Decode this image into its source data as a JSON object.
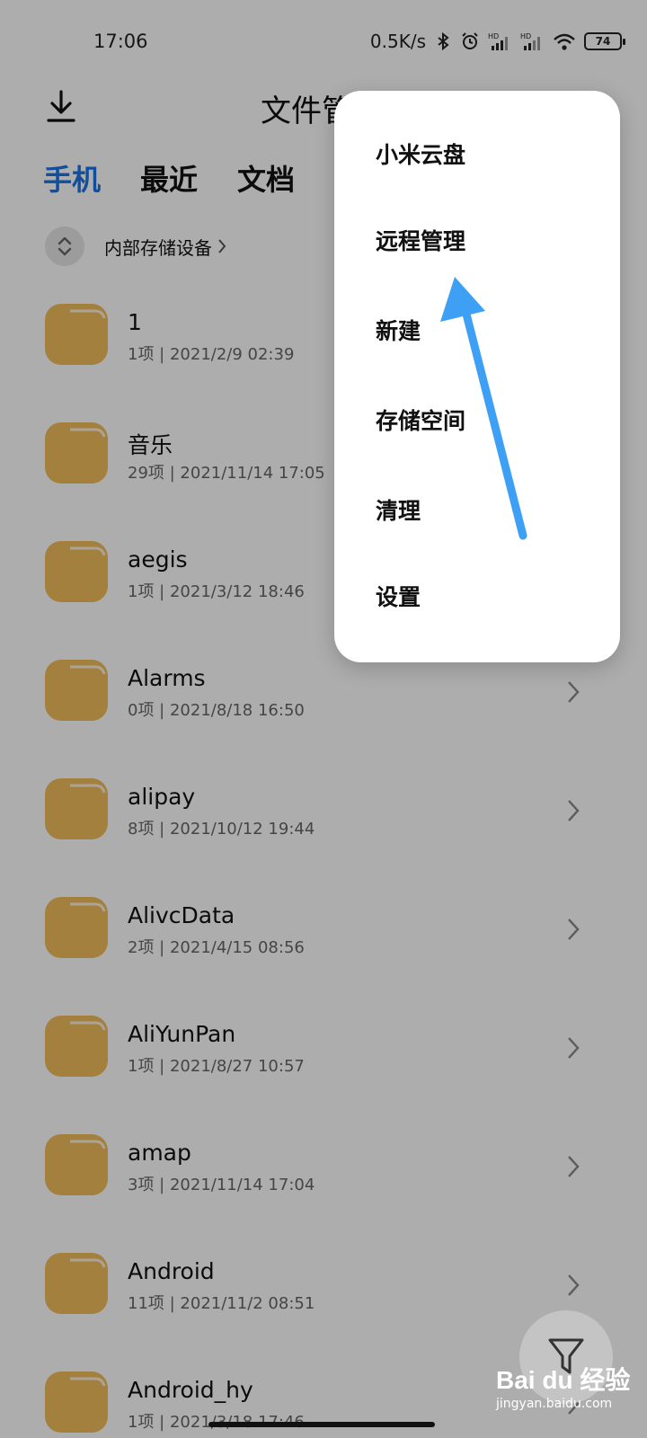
{
  "status_bar": {
    "time": "17:06",
    "net_speed": "0.5K/s",
    "battery": "74",
    "icons": [
      "bluetooth-icon",
      "alarm-icon",
      "hd-signal-icon",
      "hd-signal-icon",
      "wifi-icon",
      "battery-icon"
    ]
  },
  "header": {
    "title": "文件管理",
    "download_icon": "download-icon"
  },
  "tabs": [
    {
      "label": "手机",
      "active": true
    },
    {
      "label": "最近",
      "active": false
    },
    {
      "label": "文档",
      "active": false
    }
  ],
  "breadcrumb": {
    "label": "内部存储设备",
    "sort_icon": "sort-toggle-icon"
  },
  "files": [
    {
      "name": "1",
      "meta": "1项 | 2021/2/9 02:39"
    },
    {
      "name": "音乐",
      "meta": "29项 | 2021/11/14 17:05"
    },
    {
      "name": "aegis",
      "meta": "1项 | 2021/3/12 18:46"
    },
    {
      "name": "Alarms",
      "meta": "0项 | 2021/8/18 16:50"
    },
    {
      "name": "alipay",
      "meta": "8项 | 2021/10/12 19:44"
    },
    {
      "name": "AlivcData",
      "meta": "2项 | 2021/4/15 08:56"
    },
    {
      "name": "AliYunPan",
      "meta": "1项 | 2021/8/27 10:57"
    },
    {
      "name": "amap",
      "meta": "3项 | 2021/11/14 17:04"
    },
    {
      "name": "Android",
      "meta": "11项 | 2021/11/2 08:51"
    },
    {
      "name": "Android_hy",
      "meta": "1项 | 2021/3/18 17:46"
    }
  ],
  "menu": {
    "items": [
      "小米云盘",
      "远程管理",
      "新建",
      "存储空间",
      "清理",
      "设置"
    ]
  },
  "fab": {
    "icon": "filter-icon"
  },
  "watermark": {
    "logo": "Bai du 经验",
    "url": "jingyan.baidu.com"
  },
  "colors": {
    "accent": "#1a73e8",
    "folder": "#f0bd5a",
    "annotation_arrow": "#3ea0f5",
    "overlay": "rgba(0,0,0,0.32)"
  }
}
